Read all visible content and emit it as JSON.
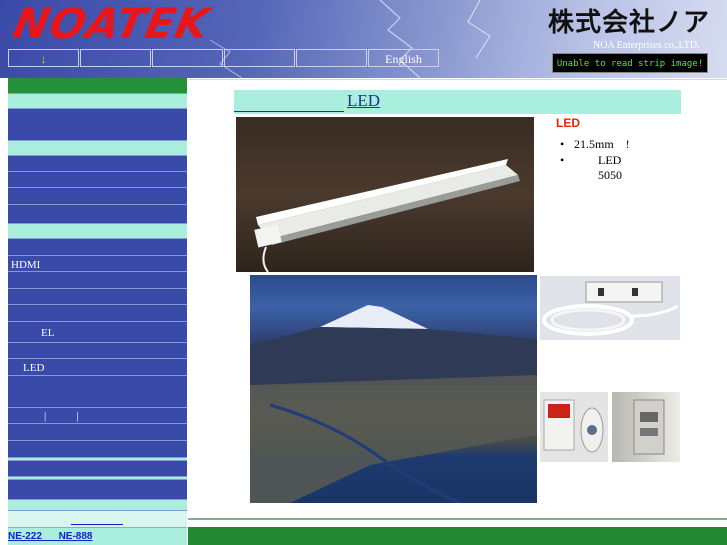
{
  "header": {
    "logo_text": "NOATEK",
    "company_jp": "株式会社ノア",
    "company_en": "NOA Enterprises co.,LTD.",
    "strip_text": "Unable to read strip image!",
    "nav": [
      {
        "label": "↓"
      },
      {
        "label": ""
      },
      {
        "label": ""
      },
      {
        "label": ""
      },
      {
        "label": ""
      },
      {
        "label": "English"
      }
    ]
  },
  "sidebar": {
    "items": [
      {
        "label": ""
      },
      {
        "label": ""
      },
      {
        "label": ""
      },
      {
        "label": ""
      },
      {
        "label": ""
      },
      {
        "label": ""
      },
      {
        "label": ""
      },
      {
        "label": "HDMI"
      },
      {
        "label": ""
      },
      {
        "label": ""
      },
      {
        "label": "EL"
      },
      {
        "label": "LED"
      },
      {
        "label": "|           |"
      },
      {
        "label": ""
      }
    ],
    "bottom_links": "NE-222      NE-888"
  },
  "main": {
    "title": "LED",
    "heading": "LED",
    "features": [
      "21.5mm    !",
      "LED 5050"
    ]
  },
  "colors": {
    "header_blue": "#3a4aa8",
    "sidebar_blue": "#3a4aa8",
    "aqua": "#aaeedd",
    "green": "#228833",
    "logo_red": "#e8161b",
    "heading_red": "#ee2200"
  }
}
